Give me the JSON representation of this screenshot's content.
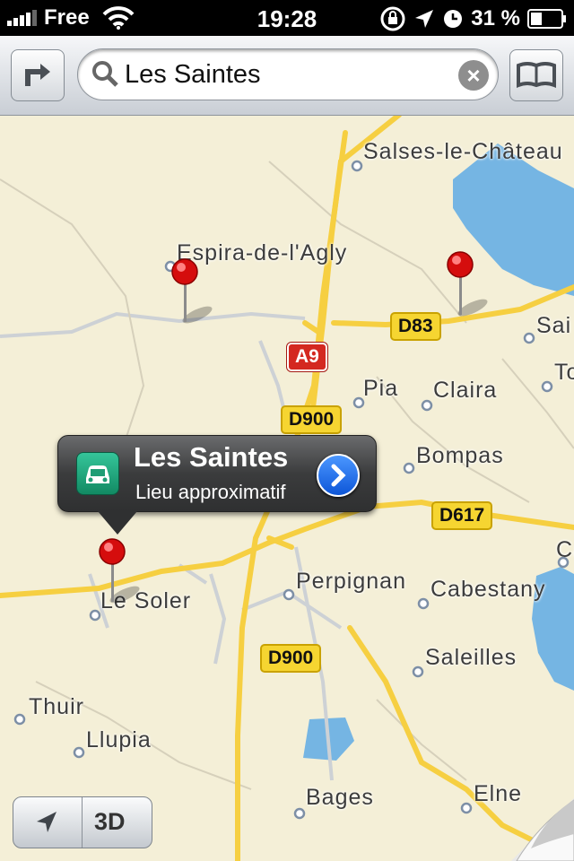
{
  "status_bar": {
    "carrier": "Free",
    "time": "19:28",
    "battery": "31 %"
  },
  "search": {
    "query": "Les Saintes"
  },
  "map": {
    "places": [
      "Salses-le-Château",
      "Espira-de-l'Agly",
      "Sai",
      "To",
      "Pia",
      "Claira",
      "Bompas",
      "Perpignan",
      "Cabestany",
      "Le Soler",
      "Saleilles",
      "Thuir",
      "Llupia",
      "Bages",
      "Elne",
      "Ca"
    ],
    "roads": [
      "D83",
      "A9",
      "D900",
      "D617",
      "D900"
    ]
  },
  "callout": {
    "title": "Les Saintes",
    "subtitle": "Lieu approximatif"
  },
  "controls": {
    "three_d": "3D"
  },
  "colors": {
    "land": "#f4efd7",
    "water": "#75b5e3",
    "road": "#f7d24a",
    "pin": "#d50d0d"
  }
}
